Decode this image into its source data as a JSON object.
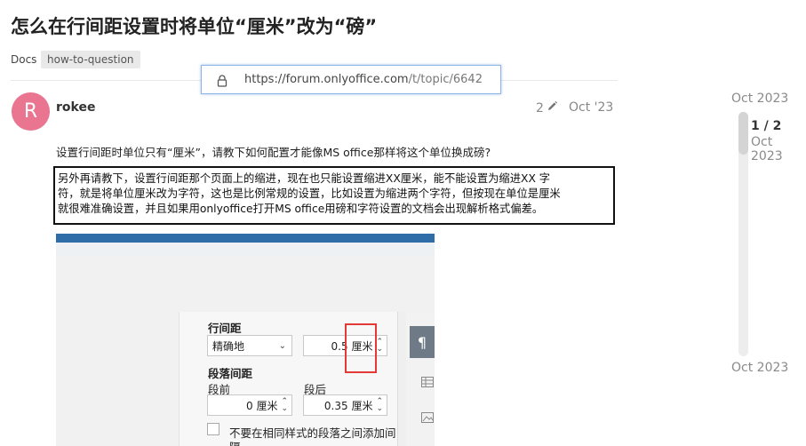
{
  "topic": {
    "title": "怎么在行间距设置时将单位“厘米”改为“磅”",
    "category": "Docs",
    "tag": "how-to-question"
  },
  "url_popup": {
    "host": "https://forum.onlyoffice.com",
    "path": "/t/topic/6642",
    "icon": "lock-icon"
  },
  "post": {
    "avatar_letter": "R",
    "avatar_color": "#e97590",
    "username": "rokee",
    "edit_count": "2",
    "edit_icon": "pencil-icon",
    "date": "Oct '23",
    "paragraph1": "设置行间距时单位只有“厘米”，请教下如何配置才能像MS office那样将这个单位换成磅?",
    "quote_lines": [
      "另外再请教下，设置行间距那个页面上的缩进，现在也只能设置缩进XX厘米，能不能设置为缩进XX 字",
      "符，就是将单位厘米改为字符，这也是比例常规的设置，比如设置为缩进两个字符，但按现在单位是厘米",
      "就很难准确设置，并且如果用onlyoffice打开MS office用磅和字符设置的文档会出现解析格式偏差。"
    ]
  },
  "screenshot": {
    "line_spacing_label": "行间距",
    "line_spacing_mode": "精确地",
    "line_spacing_value": "0.5 厘米",
    "paragraph_spacing_label": "段落间距",
    "before_label": "段前",
    "after_label": "段后",
    "before_value": "0 厘米",
    "after_value": "0.35 厘米",
    "no_space_label": "不要在相同样式的段落之间添加间",
    "no_space_label_cont": "隔",
    "paragraph_icon": "¶",
    "highlight_color": "#e53935"
  },
  "timeline": {
    "start_date": "Oct 2023",
    "position": "1 / 2",
    "current_date": "Oct 2023",
    "end_date": "Oct 2023"
  }
}
